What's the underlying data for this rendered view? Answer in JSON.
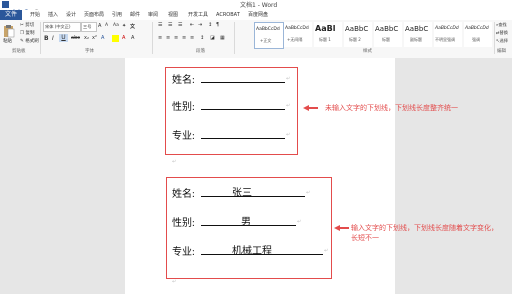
{
  "title_bar": {
    "window_title": "文档1 - Word"
  },
  "menu": {
    "file_tab": "文件",
    "tabs": [
      "开始",
      "插入",
      "设计",
      "页面布局",
      "引用",
      "邮件",
      "审阅",
      "视图",
      "开发工具",
      "ACROBAT",
      "百度网盘"
    ]
  },
  "ribbon": {
    "clipboard": {
      "paste": "粘贴",
      "cut": "剪切",
      "copy": "复制",
      "format_painter": "格式刷",
      "label": "剪贴板"
    },
    "font": {
      "font_name": "宋体 (中文正)",
      "font_size": "三号",
      "label": "字体"
    },
    "paragraph": {
      "label": "段落"
    },
    "styles": {
      "label": "样式",
      "items": [
        {
          "sample": "AaBbCcDd",
          "name": "+正文"
        },
        {
          "sample": "AaBbCcDd",
          "name": "+无间隔"
        },
        {
          "sample": "AaBl",
          "name": "标题 1"
        },
        {
          "sample": "AaBbC",
          "name": "标题 2"
        },
        {
          "sample": "AaBbC",
          "name": "标题"
        },
        {
          "sample": "AaBbC",
          "name": "副标题"
        },
        {
          "sample": "AaBbCcDd",
          "name": "不明显强调"
        },
        {
          "sample": "AaBbCcDd",
          "name": "强调"
        }
      ]
    },
    "editing": {
      "find": "查找",
      "replace": "替换",
      "select": "选择",
      "label": "编辑"
    }
  },
  "document": {
    "form1": {
      "fields": [
        {
          "label": "姓名:",
          "value": ""
        },
        {
          "label": "性别:",
          "value": ""
        },
        {
          "label": "专业:",
          "value": ""
        }
      ],
      "annotation": "未输入文字的下划线，下划线长度整齐统一"
    },
    "form2": {
      "fields": [
        {
          "label": "姓名:",
          "value": "张三"
        },
        {
          "label": "性别:",
          "value": "男"
        },
        {
          "label": "专业:",
          "value": "机械工程"
        }
      ],
      "annotation_line1": "输入文字的下划线，下划线长度随着文字变化，",
      "annotation_line2": "长短不一"
    }
  },
  "colors": {
    "accent": "#2b579a",
    "annotation_red": "#e34c4c"
  }
}
